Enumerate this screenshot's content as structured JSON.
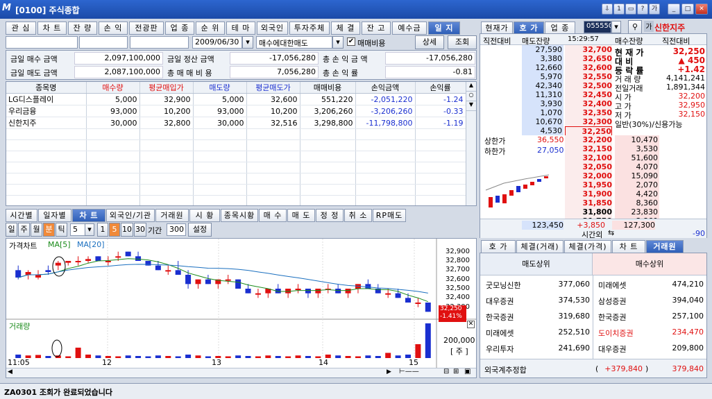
{
  "window": {
    "title": "[0100] 주식종합",
    "buttons": [
      "⇩",
      "1",
      "▭",
      "?",
      "가",
      "✕"
    ]
  },
  "tabs": [
    "관 심",
    "차 트",
    "잔 량",
    "손 익",
    "전광판",
    "업 종",
    "순 위",
    "테 마",
    "외국인",
    "투자주체",
    "체 결",
    "잔 고",
    "예수금",
    "일 지"
  ],
  "form": {
    "date": "2009/06/30",
    "select": "매수에대한매도",
    "check_label": "매매비용",
    "btn_detail": "상세",
    "btn_search": "조회"
  },
  "summary": {
    "buy_label": "금일 매수 금액",
    "buy_val": "2,097,100,000",
    "sell_label": "금일 매도 금액",
    "sell_val": "2,087,100,000",
    "settle_label": "금일 정산 금액",
    "settle_val": "-17,056,280",
    "cost_label": "총 매 매 비 용",
    "cost_val": "7,056,280",
    "pl_label": "총 손 익 금 액",
    "pl_val": "-17,056,280",
    "rate_label": "총 손 익 률",
    "rate_val": "-0.81"
  },
  "table": {
    "headers": [
      "종목명",
      "매수량",
      "평균매입가",
      "매도량",
      "평균매도가",
      "매매비용",
      "손익금액",
      "손익률"
    ],
    "rows": [
      [
        "LG디스플레이",
        "5,000",
        "32,900",
        "5,000",
        "32,600",
        "551,220",
        "-2,051,220",
        "-1.24"
      ],
      [
        "우리금융",
        "93,000",
        "10,200",
        "93,000",
        "10,200",
        "3,206,260",
        "-3,206,260",
        "-0.33"
      ],
      [
        "신한지주",
        "30,000",
        "32,800",
        "30,000",
        "32,516",
        "3,298,800",
        "-11,798,800",
        "-1.19"
      ]
    ]
  },
  "chart_tabs": [
    "시간별",
    "일자별",
    "차 트",
    "외국인/기관",
    "거래원",
    "시 황",
    "종목시황",
    "매 수",
    "매 도",
    "정 정",
    "취 소",
    "RP매도"
  ],
  "chart_ctrl": {
    "periods": [
      "일",
      "주",
      "월",
      "분",
      "틱"
    ],
    "n": "5",
    "btns": [
      "1",
      "5",
      "10",
      "30"
    ],
    "gigan_label": "기간",
    "gigan": "300",
    "setting": "설정"
  },
  "chart": {
    "title": "가격차트",
    "ma5": "MA[5]",
    "ma20": "MA[20]",
    "yticks": [
      "32,900",
      "32,800",
      "32,700",
      "32,600",
      "32,500",
      "32,400",
      "32,300"
    ],
    "cur": "32,250",
    "pct": "-1.41%",
    "vol_title": "거래량",
    "vol_ticks": [
      "200,000",
      "[ 주 ]"
    ],
    "xlabels": [
      "11:05",
      "12",
      "13",
      "14",
      "15"
    ]
  },
  "chart_data": {
    "type": "candlestick",
    "title": "가격차트",
    "ylim": [
      32200,
      32950
    ],
    "candles": [
      [
        32700,
        32750,
        32600,
        32620
      ],
      [
        32650,
        32700,
        32600,
        32680
      ],
      [
        32620,
        32700,
        32600,
        32650
      ],
      [
        32700,
        32750,
        32650,
        32680
      ],
      [
        32750,
        32800,
        32700,
        32780
      ],
      [
        32780,
        32800,
        32750,
        32800
      ],
      [
        32800,
        32850,
        32750,
        32800
      ],
      [
        32800,
        32850,
        32780,
        32820
      ],
      [
        32850,
        32850,
        32800,
        32800
      ],
      [
        32800,
        32850,
        32750,
        32800
      ],
      [
        32850,
        32900,
        32800,
        32850
      ],
      [
        32900,
        32900,
        32850,
        32850
      ],
      [
        32850,
        32900,
        32800,
        32800
      ],
      [
        32800,
        32800,
        32750,
        32750
      ],
      [
        32750,
        32800,
        32700,
        32700
      ],
      [
        32700,
        32750,
        32650,
        32700
      ],
      [
        32700,
        32800,
        32650,
        32650
      ],
      [
        32650,
        32700,
        32500,
        32550
      ],
      [
        32550,
        32600,
        32500,
        32600
      ],
      [
        32600,
        32650,
        32550,
        32550
      ],
      [
        32550,
        32600,
        32500,
        32600
      ],
      [
        32600,
        32650,
        32550,
        32600
      ],
      [
        32600,
        32600,
        32500,
        32500
      ],
      [
        32500,
        32550,
        32450,
        32450
      ],
      [
        32450,
        32500,
        32400,
        32450
      ],
      [
        32450,
        32500,
        32400,
        32500
      ],
      [
        32500,
        32550,
        32450,
        32450
      ],
      [
        32450,
        32500,
        32400,
        32500
      ],
      [
        32500,
        32550,
        32450,
        32500
      ],
      [
        32500,
        32500,
        32400,
        32450
      ],
      [
        32450,
        32500,
        32400,
        32500
      ],
      [
        32500,
        32550,
        32450,
        32500
      ],
      [
        32500,
        32550,
        32450,
        32450
      ],
      [
        32450,
        32500,
        32400,
        32500
      ],
      [
        32500,
        32550,
        32450,
        32550
      ],
      [
        32550,
        32600,
        32500,
        32500
      ],
      [
        32500,
        32550,
        32450,
        32450
      ],
      [
        32450,
        32500,
        32400,
        32450
      ],
      [
        32450,
        32500,
        32400,
        32400
      ],
      [
        32400,
        32450,
        32350,
        32350
      ],
      [
        32350,
        32400,
        32300,
        32350
      ],
      [
        32350,
        32350,
        32250,
        32250
      ]
    ],
    "volume": [
      20000,
      15000,
      18000,
      12000,
      15000,
      10000,
      60000,
      20000,
      15000,
      12000,
      10000,
      15000,
      12000,
      10000,
      15000,
      12000,
      10000,
      20000,
      15000,
      10000,
      12000,
      10000,
      15000,
      12000,
      10000,
      15000,
      12000,
      10000,
      15000,
      12000,
      10000,
      20000,
      15000,
      12000,
      10000,
      15000,
      12000,
      30000,
      15000,
      20000,
      80000,
      200000
    ]
  },
  "right_tabs": [
    "현재가",
    "호 가",
    "업 종"
  ],
  "code": "055550",
  "stock_name": "신한지주",
  "ob_headers": [
    "직전대비",
    "매도잔량",
    "15:29:57",
    "매수잔량",
    "직전대비"
  ],
  "asks": [
    [
      "27,590",
      "32,700"
    ],
    [
      "3,380",
      "32,650"
    ],
    [
      "12,660",
      "32,600"
    ],
    [
      "5,970",
      "32,550"
    ],
    [
      "42,340",
      "32,500"
    ],
    [
      "11,310",
      "32,450"
    ],
    [
      "3,930",
      "32,400"
    ],
    [
      "1,070",
      "32,350"
    ],
    [
      "10,670",
      "32,300"
    ],
    [
      "4,530",
      "32,250"
    ]
  ],
  "bids": [
    [
      "32,200",
      "10,470"
    ],
    [
      "32,150",
      "3,530"
    ],
    [
      "32,100",
      "51,600"
    ],
    [
      "32,050",
      "4,070"
    ],
    [
      "32,000",
      "15,090"
    ],
    [
      "31,950",
      "2,070"
    ],
    [
      "31,900",
      "4,420"
    ],
    [
      "31,850",
      "8,360"
    ],
    [
      "31,800",
      "23,830"
    ],
    [
      "31,750",
      "3,860"
    ]
  ],
  "quote": [
    [
      "현 재 가",
      "32,250"
    ],
    [
      "대    비",
      "▲  450"
    ],
    [
      "등 락 률",
      "+1.42"
    ],
    [
      "거 래 량",
      "4,141,241"
    ],
    [
      "전일거래",
      "1,891,344"
    ],
    [
      "시    가",
      "32,200"
    ],
    [
      "고    가",
      "32,950"
    ],
    [
      "저    가",
      "32,150"
    ],
    [
      "일반(30%)/신용가능",
      ""
    ]
  ],
  "limits": {
    "up_label": "상한가",
    "up": "36,550",
    "down_label": "하한가",
    "down": "27,050"
  },
  "ob_footer": {
    "ask_total": "123,450",
    "diff": "+3,850",
    "bid_total": "127,300",
    "bid_diff": "-90",
    "time_label": "시간외"
  },
  "bottom_tabs": [
    "호 가",
    "체결(거래)",
    "체결(가격)",
    "차 트",
    "거래원"
  ],
  "broker": {
    "sell_h": "매도상위",
    "buy_h": "매수상위",
    "rows": [
      [
        "굿모닝신한",
        "377,060",
        "미래에셋",
        "474,210"
      ],
      [
        "대우증권",
        "374,530",
        "삼성증권",
        "394,040"
      ],
      [
        "한국증권",
        "319,680",
        "한국증권",
        "257,100"
      ],
      [
        "미래에셋",
        "252,510",
        "도이치증권",
        "234,470"
      ],
      [
        "우리투자",
        "241,690",
        "대우증권",
        "209,800"
      ]
    ],
    "foreign_label": "외국계추정합",
    "foreign_diff": "+379,840",
    "foreign_val": "379,840"
  },
  "status": "ZA0301 조회가 완료되었습니다"
}
